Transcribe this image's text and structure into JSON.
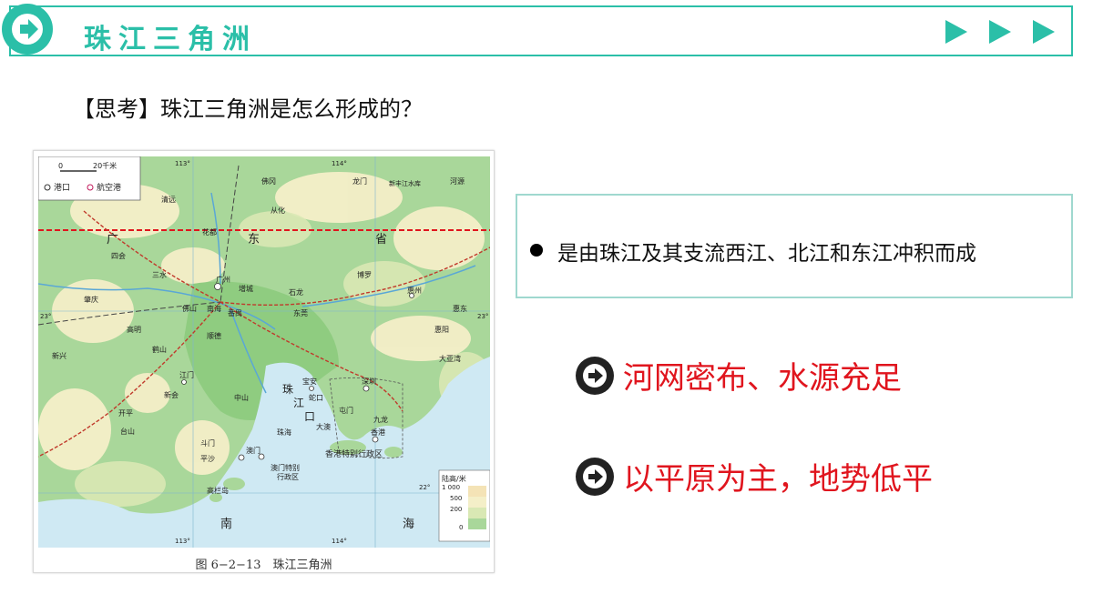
{
  "header": {
    "title": "珠江三角洲",
    "accent_color": "#2bbfa8",
    "badge_icon": "arrow-right-circle-icon",
    "nav_icons": [
      "play-triangle-icon",
      "play-triangle-icon",
      "play-triangle-icon"
    ]
  },
  "question": "【思考】珠江三角洲是怎么形成的？",
  "map": {
    "caption": "图 6−2−13　珠江三角洲",
    "scale_zero": "0",
    "scale_label": "20千米",
    "legend_port": "港口",
    "legend_airport": "航空港",
    "elevation_title": "陆高/米",
    "elevation_levels": [
      "1 000",
      "500",
      "200",
      "0"
    ],
    "region_label": "香港特别行政区",
    "macao_label_1": "澳门特别",
    "macao_label_2": "行政区",
    "province_chars": [
      "广",
      "东",
      "省"
    ],
    "sea_chars": [
      "南",
      "海"
    ],
    "estuary_chars": [
      "珠",
      "江",
      "口"
    ],
    "lon_labels": [
      "113°",
      "114°",
      "113°",
      "114°"
    ],
    "lat_labels": [
      "23°",
      "22°",
      "23°"
    ],
    "cities": [
      "清远",
      "从化",
      "花都",
      "四会",
      "三水",
      "广州",
      "增城",
      "博罗",
      "惠州",
      "肇庆",
      "佛山",
      "南海",
      "番禺",
      "石龙",
      "东莞",
      "惠东",
      "高明",
      "顺德",
      "惠阳",
      "鹤山",
      "新兴",
      "江门",
      "宝安",
      "深圳",
      "中山",
      "蛇口",
      "新会",
      "斗门",
      "珠海",
      "澳门",
      "香港",
      "九龙",
      "开平",
      "台山",
      "平沙",
      "高栏岛",
      "大澳",
      "屯门",
      "龙门",
      "河源",
      "佛冈"
    ],
    "bay_label": "大亚湾",
    "river_label": "新丰江水库"
  },
  "answer": "是由珠江及其支流西江、北江和东江冲积而成",
  "points": [
    {
      "text": "河网密布、水源充足",
      "icon": "arrow-right-circle-icon"
    },
    {
      "text": "以平原为主，地势低平",
      "icon": "arrow-right-circle-icon"
    }
  ],
  "colors": {
    "point_text": "#e0151e",
    "sea": "#cfe9f3",
    "lowland": "#a9d79a",
    "hill": "#f4efc8"
  }
}
